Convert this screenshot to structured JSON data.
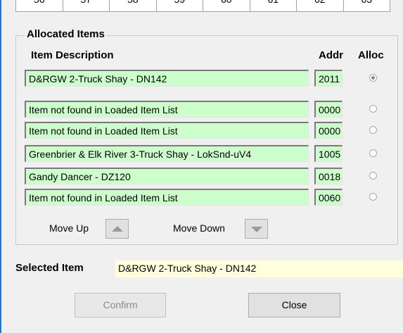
{
  "slot_strip": {
    "numbers": [
      "56",
      "57",
      "58",
      "59",
      "60",
      "61",
      "62",
      "63"
    ]
  },
  "allocated": {
    "title": "Allocated Items",
    "headers": {
      "description": "Item Description",
      "addr": "Addr",
      "alloc": "Alloc"
    },
    "rows": [
      {
        "description": "D&RGW 2-Truck Shay - DN142",
        "addr": "2011",
        "allocated": true
      },
      {
        "description": "Item not found in Loaded Item List",
        "addr": "0000",
        "allocated": false
      },
      {
        "description": "Item not found in Loaded Item List",
        "addr": "0000",
        "allocated": false
      },
      {
        "description": "Greenbrier & Elk River 3-Truck Shay - LokSnd-uV4",
        "addr": "1005",
        "allocated": false
      },
      {
        "description": "Gandy Dancer - DZ120",
        "addr": "0018",
        "allocated": false
      },
      {
        "description": "Item not found in Loaded Item List",
        "addr": "0060",
        "allocated": false
      }
    ],
    "move_up_label": "Move Up",
    "move_down_label": "Move Down"
  },
  "selected": {
    "label": "Selected Item",
    "value": "D&RGW 2-Truck Shay - DN142"
  },
  "buttons": {
    "confirm": "Confirm",
    "close": "Close"
  },
  "colors": {
    "field_bg": "#ccffcc",
    "selected_bg": "#ffffdd",
    "window_border": "#1e78d2"
  }
}
